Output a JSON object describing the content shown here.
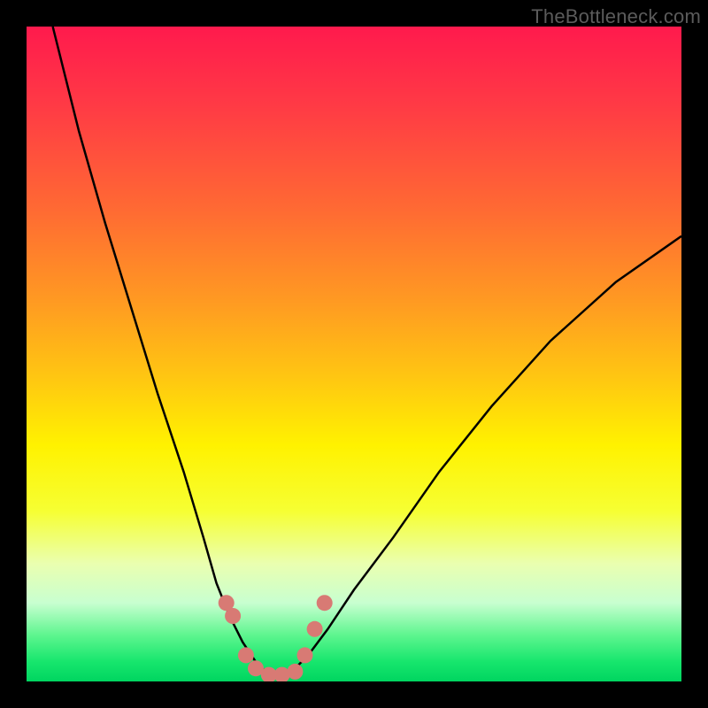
{
  "watermark": "TheBottleneck.com",
  "chart_data": {
    "type": "line",
    "title": "",
    "xlabel": "",
    "ylabel": "",
    "xlim": [
      0,
      100
    ],
    "ylim": [
      0,
      100
    ],
    "series": [
      {
        "name": "curve",
        "x": [
          4,
          8,
          12,
          16,
          20,
          24,
          27,
          29,
          31,
          33,
          35,
          37,
          39,
          41,
          43,
          46,
          50,
          56,
          63,
          71,
          80,
          90,
          100
        ],
        "values": [
          100,
          84,
          70,
          57,
          44,
          32,
          22,
          15,
          10,
          6,
          3,
          1,
          1,
          2,
          4,
          8,
          14,
          22,
          32,
          42,
          52,
          61,
          68
        ]
      },
      {
        "name": "markers",
        "x": [
          30.5,
          31.5,
          33.5,
          35,
          37,
          39,
          41,
          42.5,
          44,
          45.5
        ],
        "values": [
          12,
          10,
          4,
          2,
          1,
          1,
          1.5,
          4,
          8,
          12
        ]
      }
    ],
    "marker_color": "#d87a74",
    "curve_color": "#000000"
  }
}
